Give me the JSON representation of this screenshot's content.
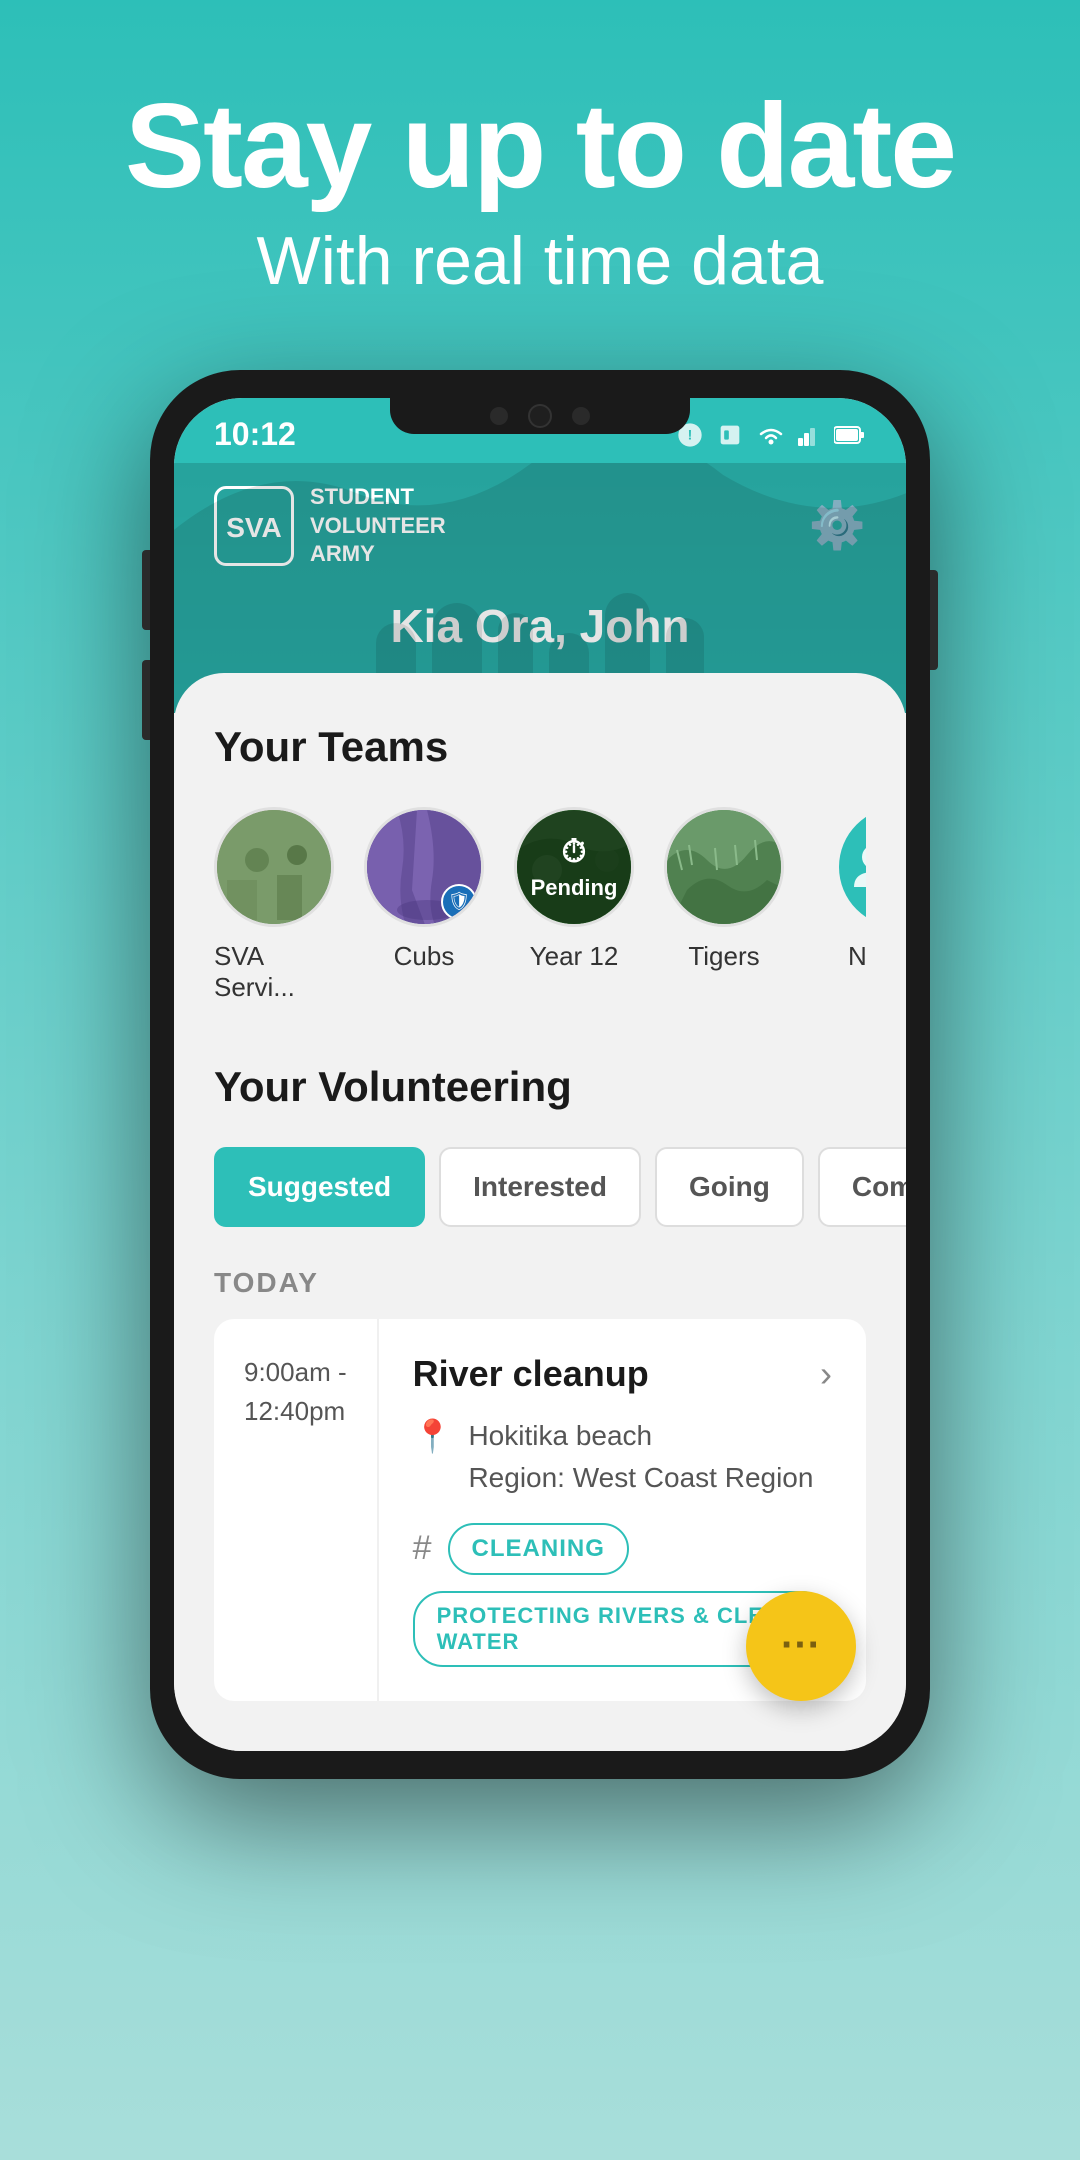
{
  "hero": {
    "title": "Stay up to date",
    "subtitle": "With real time data"
  },
  "status_bar": {
    "time": "10:12",
    "wifi": true,
    "signal": true,
    "battery": true
  },
  "app_header": {
    "logo_line1": "STUDENT",
    "logo_line2": "VOLUNTEER",
    "logo_line3": "ARMY",
    "greeting": "Kia Ora, John",
    "settings_label": "settings"
  },
  "teams_section": {
    "title": "Your Teams",
    "teams": [
      {
        "name": "SVA Servi...",
        "type": "image",
        "bg": "bg1",
        "badge": null,
        "pending": false
      },
      {
        "name": "Cubs",
        "type": "image",
        "bg": "bg2",
        "badge": "shield",
        "pending": false
      },
      {
        "name": "Year 12",
        "type": "image",
        "bg": "bg3",
        "badge": null,
        "pending": true
      },
      {
        "name": "Tigers",
        "type": "image",
        "bg": "bg4",
        "badge": null,
        "pending": false
      },
      {
        "name": "New",
        "type": "partial",
        "bg": "bg5",
        "badge": null,
        "pending": false
      }
    ],
    "pending_label": "Pending"
  },
  "volunteering_section": {
    "title": "Your Volunteering",
    "tabs": [
      {
        "label": "Suggested",
        "active": true
      },
      {
        "label": "Interested",
        "active": false
      },
      {
        "label": "Going",
        "active": false
      },
      {
        "label": "Completed",
        "active": false
      }
    ],
    "today_label": "TODAY",
    "events": [
      {
        "time_start": "9:00am -",
        "time_end": "12:40pm",
        "title": "River cleanup",
        "location_line1": "Hokitika beach",
        "location_line2": "Region: West Coast Region",
        "tags": [
          "CLEANING",
          "PROTECTING RIVERS & CLEAN WATER"
        ]
      }
    ]
  },
  "fab": {
    "label": "···"
  }
}
